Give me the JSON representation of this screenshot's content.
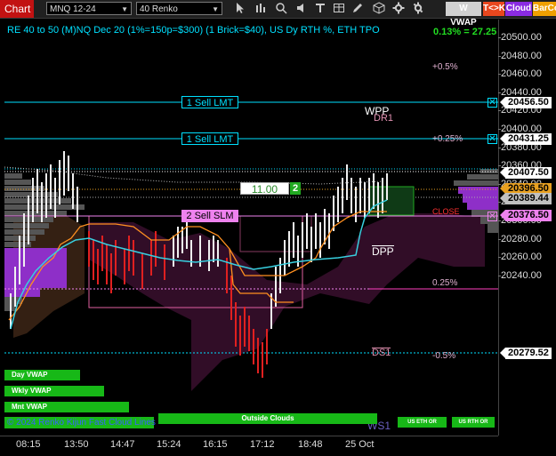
{
  "toolbar": {
    "chart_tab": "Chart",
    "instrument": "MNQ 12-24",
    "interval": "40 Renko",
    "icons": [
      "cursor-icon",
      "bars-icon",
      "magnifier-icon",
      "speaker-icon",
      "text-icon",
      "table-icon",
      "pencil-icon",
      "cube-icon",
      "gear-icon"
    ],
    "wvwap_label": "W VWAP",
    "tk_label": "T<>K",
    "cloud_label": "Cloud",
    "barco_label": "BarCo",
    "colors": {
      "chart_tab": "#c21212",
      "wvwap": "#d0d0d0",
      "tk": "#e8471e",
      "cloud": "#8a2be2",
      "barco": "#f0a000"
    }
  },
  "header": {
    "description": "RE 40 to 50 (M)NQ Dec 20 (1%=150p=$300) (1 Brick=$40), US Dy RTH %, ETH TPO",
    "change": "0.13% = 27.25"
  },
  "price_axis": {
    "ticks": [
      "20500.00",
      "20480.00",
      "20460.00",
      "20440.00",
      "20420.00",
      "20400.00",
      "20380.00",
      "20360.00",
      "20340.00",
      "20320.00",
      "20300.00",
      "20280.00",
      "20260.00",
      "20240.00"
    ],
    "flags": [
      {
        "name": "price-flag-sell-lmt-1",
        "label": "20456.50",
        "bg": "#ffffff",
        "fg": "#000000"
      },
      {
        "name": "price-flag-sell-lmt-2",
        "label": "20431.25",
        "bg": "#ffffff",
        "fg": "#000000"
      },
      {
        "name": "price-flag-last",
        "label": "20407.50",
        "bg": "#ffffff",
        "fg": "#000000"
      },
      {
        "name": "price-flag-ma",
        "label": "20396.50",
        "bg": "#e8a020",
        "fg": "#000000"
      },
      {
        "name": "price-flag-vwap",
        "label": "20389.44",
        "bg": "#c0c0c0",
        "fg": "#000000"
      },
      {
        "name": "price-flag-sell-slm",
        "label": "20376.50",
        "bg": "#ee82ee",
        "fg": "#000000"
      },
      {
        "name": "price-flag-ds1",
        "label": "20279.52",
        "bg": "#ffffff",
        "fg": "#000000"
      }
    ]
  },
  "time_axis": [
    "08:15",
    "13:50",
    "14:47",
    "15:24",
    "16:15",
    "17:12",
    "18:48",
    "25 Oct"
  ],
  "orders": {
    "sell_lmt_1": "1 Sell LMT",
    "sell_lmt_2": "1 Sell LMT",
    "sell_slm": "2 Sell SLM",
    "price_box": "11.00",
    "qty": "2",
    "close_x": "✕"
  },
  "levels": {
    "plus_half": "+0.5%",
    "plus_quarter": "+0.25%",
    "wpp": "WPP",
    "dr1": "DR1",
    "close": "CLOSE",
    "dpp": "DPP",
    "minus_quarter": "0.25%",
    "ds1": "DS1",
    "minus_half": "-0.5%",
    "ws1": "WS1"
  },
  "vwap_buttons": {
    "day": "Day VWAP",
    "wkly": "Wkly VWAP",
    "mnt": "Mnt VWAP",
    "outside_clouds": "Outside Clouds",
    "us_eth_1": "US ETH OR",
    "us_rth": "US RTH OR"
  },
  "footer_text": "© 2024 Renko Kijun Fast Cloud Lines"
}
